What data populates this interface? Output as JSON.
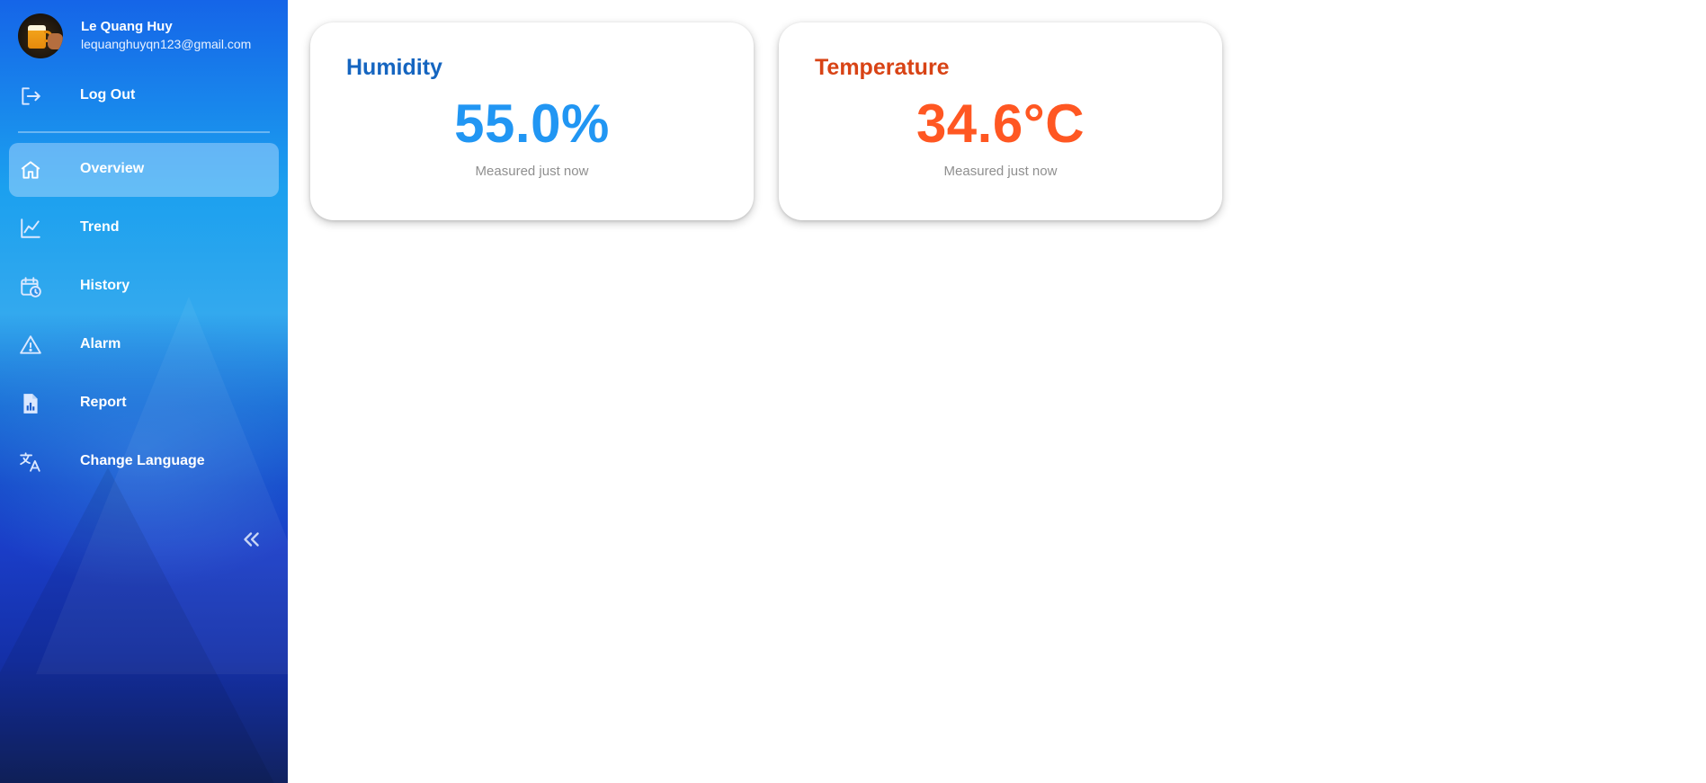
{
  "sidebar": {
    "profile": {
      "name": "Le Quang Huy",
      "email": "lequanghuyqn123@gmail.com"
    },
    "logout": {
      "label": "Log Out",
      "icon": "logout-icon"
    },
    "items": [
      {
        "label": "Overview",
        "icon": "home-icon",
        "active": true
      },
      {
        "label": "Trend",
        "icon": "trend-chart-icon",
        "active": false
      },
      {
        "label": "History",
        "icon": "calendar-clock-icon",
        "active": false
      },
      {
        "label": "Alarm",
        "icon": "warning-triangle-icon",
        "active": false
      },
      {
        "label": "Report",
        "icon": "report-file-icon",
        "active": false
      },
      {
        "label": "Change Language",
        "icon": "translate-icon",
        "active": false
      }
    ],
    "collapse_icon": "double-chevron-left-icon"
  },
  "cards": {
    "humidity": {
      "title": "Humidity",
      "value": "55.0%",
      "note": "Measured just now",
      "title_color": "#1565c0",
      "value_color": "#2196f3"
    },
    "temperature": {
      "title": "Temperature",
      "value": "34.6°C",
      "note": "Measured just now",
      "title_color": "#d84315",
      "value_color": "#ff5722"
    }
  },
  "colors": {
    "sidebar_top": "#1565e8",
    "sidebar_bottom": "#11225f",
    "active_item_bg": "#8cc8f7"
  }
}
